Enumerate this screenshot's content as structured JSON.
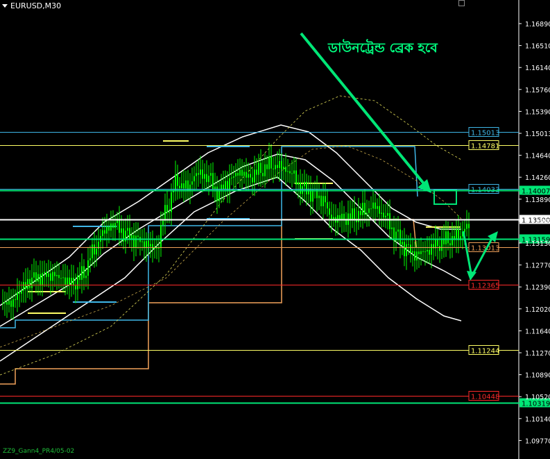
{
  "window": {
    "symbol_label": "EURUSD,M30"
  },
  "annotation": {
    "text": "ডাউনট্রেন্ড ব্রেক হবে"
  },
  "footer": {
    "text": "ZZ9_Gann4_PR4/05-02"
  },
  "colors": {
    "background": "#000000",
    "candle_green": "#00ff00",
    "text_green": "#00ff7f",
    "grid": "#ffffff",
    "band_white": "#ffffff",
    "cyan": "#3fb7e8",
    "orange": "#f2a25a",
    "yellow": "#ffff66",
    "red": "#ff2a2a",
    "highlight_green": "#00e676"
  },
  "chart_data": {
    "type": "candlestick",
    "symbol": "EURUSD",
    "timeframe": "M30",
    "y_axis_ticks": [
      "1.16890",
      "1.16510",
      "1.16140",
      "1.15760",
      "1.15390",
      "1.15013",
      "1.14640",
      "1.14260",
      "1.13890",
      "1.13500",
      "1.13130",
      "1.12770",
      "1.12390",
      "1.12020",
      "1.11640",
      "1.11270",
      "1.10890",
      "1.10520",
      "1.10140",
      "1.09770"
    ],
    "ylim": [
      1.0975,
      1.1724
    ],
    "price_levels": [
      {
        "label": "1.15013",
        "value": 1.15013,
        "color": "#3fb7e8",
        "style": "outline"
      },
      {
        "label": "1.14781",
        "value": 1.14781,
        "color": "#ffff66",
        "style": "outline"
      },
      {
        "label": "1.14033",
        "value": 1.14033,
        "color": "#3fb7e8",
        "style": "outline"
      },
      {
        "label": "1.14007",
        "value": 1.14007,
        "color": "#00e676",
        "style": "filled"
      },
      {
        "label": "1.13500",
        "value": 1.135,
        "color": "#ffffff",
        "style": "filled"
      },
      {
        "label": "1.13159",
        "value": 1.13159,
        "color": "#00e676",
        "style": "filled"
      },
      {
        "label": "1.13013",
        "value": 1.13013,
        "color": "#f2a25a",
        "style": "outline"
      },
      {
        "label": "1.12365",
        "value": 1.12365,
        "color": "#ff2a2a",
        "style": "outline"
      },
      {
        "label": "1.11244",
        "value": 1.11244,
        "color": "#ffff66",
        "style": "outline"
      },
      {
        "label": "1.10448",
        "value": 1.10448,
        "color": "#ff2a2a",
        "style": "outline"
      },
      {
        "label": "1.10319",
        "value": 1.10319,
        "color": "#00e676",
        "style": "filled"
      }
    ],
    "trend_path_x": [
      0,
      15,
      30,
      45,
      60,
      75,
      90,
      105,
      120,
      135,
      150,
      165,
      180,
      195,
      210,
      225,
      240,
      255,
      270,
      285,
      300,
      315,
      330,
      345,
      360,
      375,
      390,
      405,
      420,
      435,
      450,
      465,
      480,
      495,
      510,
      525,
      540,
      555,
      570,
      585,
      600,
      615,
      630,
      645,
      660
    ],
    "trend_path_close": [
      1.1205,
      1.1225,
      1.124,
      1.1245,
      1.125,
      1.1248,
      1.1242,
      1.126,
      1.13,
      1.133,
      1.134,
      1.132,
      1.131,
      1.1305,
      1.13,
      1.137,
      1.142,
      1.141,
      1.143,
      1.142,
      1.139,
      1.141,
      1.143,
      1.1425,
      1.144,
      1.145,
      1.1445,
      1.143,
      1.14,
      1.139,
      1.138,
      1.135,
      1.1355,
      1.136,
      1.137,
      1.1375,
      1.1355,
      1.132,
      1.1295,
      1.1285,
      1.1295,
      1.131,
      1.132,
      1.1325,
      1.134
    ]
  }
}
